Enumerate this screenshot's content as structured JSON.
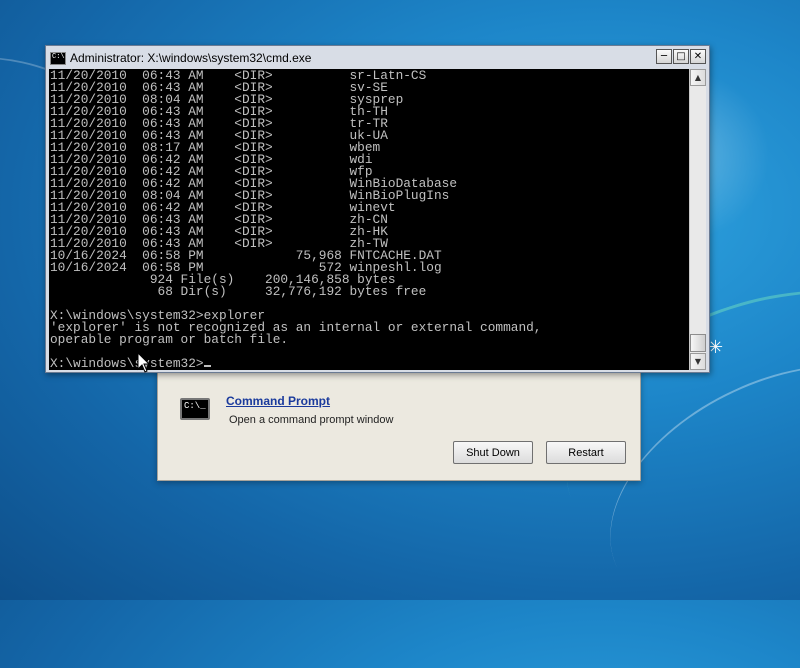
{
  "cmd_window": {
    "title": "Administrator: X:\\windows\\system32\\cmd.exe",
    "icon_text": "C:\\",
    "controls": {
      "minimize": "─",
      "maximize": "□",
      "close": "✕"
    },
    "lines": [
      "11/20/2010  06:43 AM    <DIR>          sr-Latn-CS",
      "11/20/2010  06:43 AM    <DIR>          sv-SE",
      "11/20/2010  08:04 AM    <DIR>          sysprep",
      "11/20/2010  06:43 AM    <DIR>          th-TH",
      "11/20/2010  06:43 AM    <DIR>          tr-TR",
      "11/20/2010  06:43 AM    <DIR>          uk-UA",
      "11/20/2010  08:17 AM    <DIR>          wbem",
      "11/20/2010  06:42 AM    <DIR>          wdi",
      "11/20/2010  06:42 AM    <DIR>          wfp",
      "11/20/2010  06:42 AM    <DIR>          WinBioDatabase",
      "11/20/2010  08:04 AM    <DIR>          WinBioPlugIns",
      "11/20/2010  06:42 AM    <DIR>          winevt",
      "11/20/2010  06:43 AM    <DIR>          zh-CN",
      "11/20/2010  06:43 AM    <DIR>          zh-HK",
      "11/20/2010  06:43 AM    <DIR>          zh-TW",
      "10/16/2024  06:58 PM            75,968 FNTCACHE.DAT",
      "10/16/2024  06:58 PM               572 winpeshl.log",
      "             924 File(s)    200,146,858 bytes",
      "              68 Dir(s)     32,776,192 bytes free",
      "",
      "X:\\windows\\system32>explorer",
      "'explorer' is not recognized as an internal or external command,",
      "operable program or batch file.",
      "",
      "X:\\windows\\system32>"
    ],
    "scroll": {
      "up_arrow": "▲",
      "down_arrow": "▼"
    }
  },
  "recovery_dialog": {
    "command_prompt_icon_text": "C:\\_",
    "command_prompt_link": "Command Prompt",
    "command_prompt_desc": "Open a command prompt window",
    "shutdown_label": "Shut Down",
    "restart_label": "Restart"
  },
  "desktop": {
    "sparkle": "✳"
  }
}
